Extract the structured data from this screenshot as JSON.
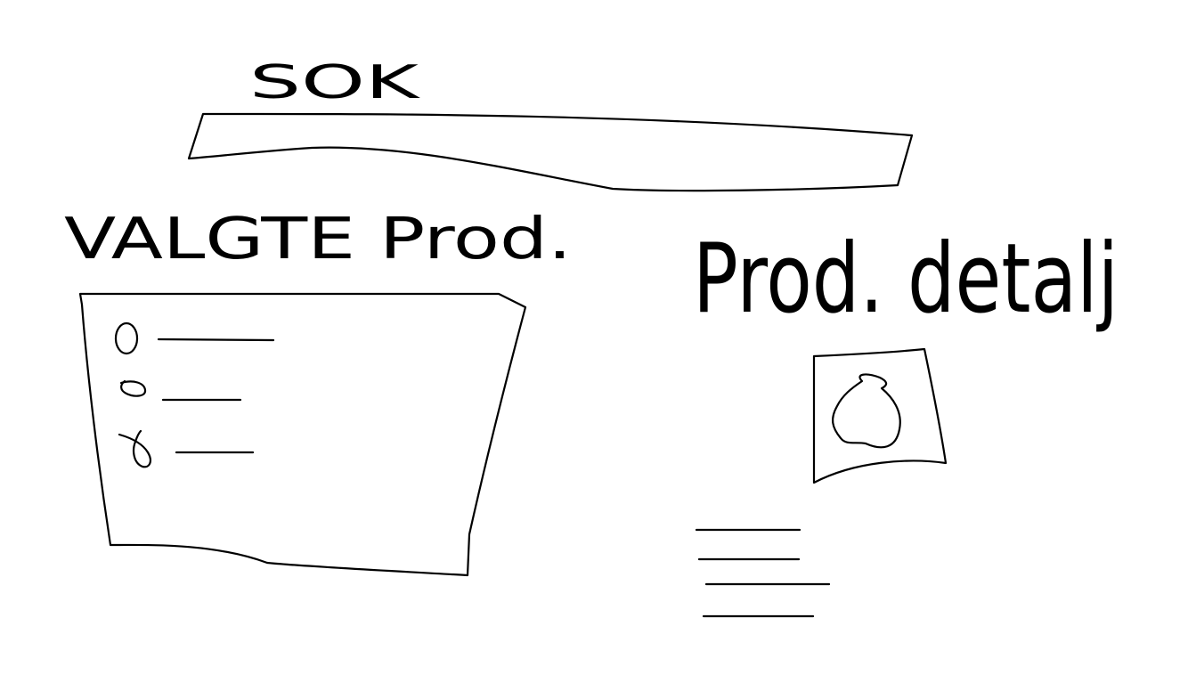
{
  "search": {
    "label": "SOK",
    "value": "",
    "placeholder": ""
  },
  "selected_products": {
    "title": "VALGTE Prod.",
    "items": [
      {
        "bullet_icon": "circle-bullet-icon"
      },
      {
        "bullet_icon": "small-loop-bullet-icon"
      },
      {
        "bullet_icon": "loop-bullet-icon"
      }
    ]
  },
  "product_detail": {
    "title": "Prod. detalj",
    "image_icon": "apple-icon",
    "description_lines": 4
  },
  "colors": {
    "ink": "#000000",
    "background": "#ffffff"
  }
}
